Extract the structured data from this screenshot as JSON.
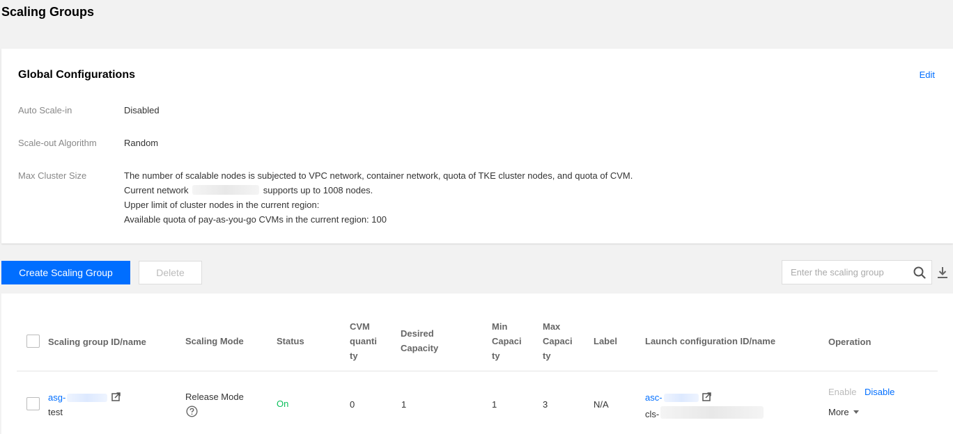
{
  "page": {
    "title": "Scaling Groups"
  },
  "global": {
    "title": "Global Configurations",
    "edit_label": "Edit",
    "auto_scale_in": {
      "label": "Auto Scale-in",
      "value": "Disabled"
    },
    "scale_out_algorithm": {
      "label": "Scale-out Algorithm",
      "value": "Random"
    },
    "max_cluster_size": {
      "label": "Max Cluster Size",
      "line1": "The number of scalable nodes is subjected to VPC network, container network, quota of TKE cluster nodes, and quota of CVM.",
      "line2_prefix": "Current network",
      "line2_suffix": "supports up to 1008 nodes.",
      "line3": "Upper limit of cluster nodes in the current region:",
      "line4": "Available quota of pay-as-you-go CVMs in the current region: 100"
    }
  },
  "toolbar": {
    "create_label": "Create Scaling Group",
    "delete_label": "Delete",
    "search_placeholder": "Enter the scaling group"
  },
  "table": {
    "headers": {
      "id_name": "Scaling group ID/name",
      "mode": "Scaling Mode",
      "status": "Status",
      "cvm_qty_l1": "CVM",
      "cvm_qty_l2": "quanti",
      "cvm_qty_l3": "ty",
      "desired_l1": "Desired",
      "desired_l2": "Capacity",
      "min_l1": "Min",
      "min_l2": "Capaci",
      "min_l3": "ty",
      "max_l1": "Max",
      "max_l2": "Capaci",
      "max_l3": "ty",
      "label": "Label",
      "launch_config": "Launch configuration ID/name",
      "operation": "Operation"
    },
    "rows": [
      {
        "id": "asg-",
        "name": "test",
        "mode": "Release Mode",
        "status": "On",
        "cvm_qty": "0",
        "desired": "1",
        "min": "1",
        "max": "3",
        "label": "N/A",
        "launch_id": "asc-",
        "launch_name": "cls-",
        "op_enable": "Enable",
        "op_disable": "Disable",
        "op_more": "More"
      }
    ]
  },
  "colors": {
    "accent": "#006eff",
    "status_on": "#0abf5b"
  }
}
